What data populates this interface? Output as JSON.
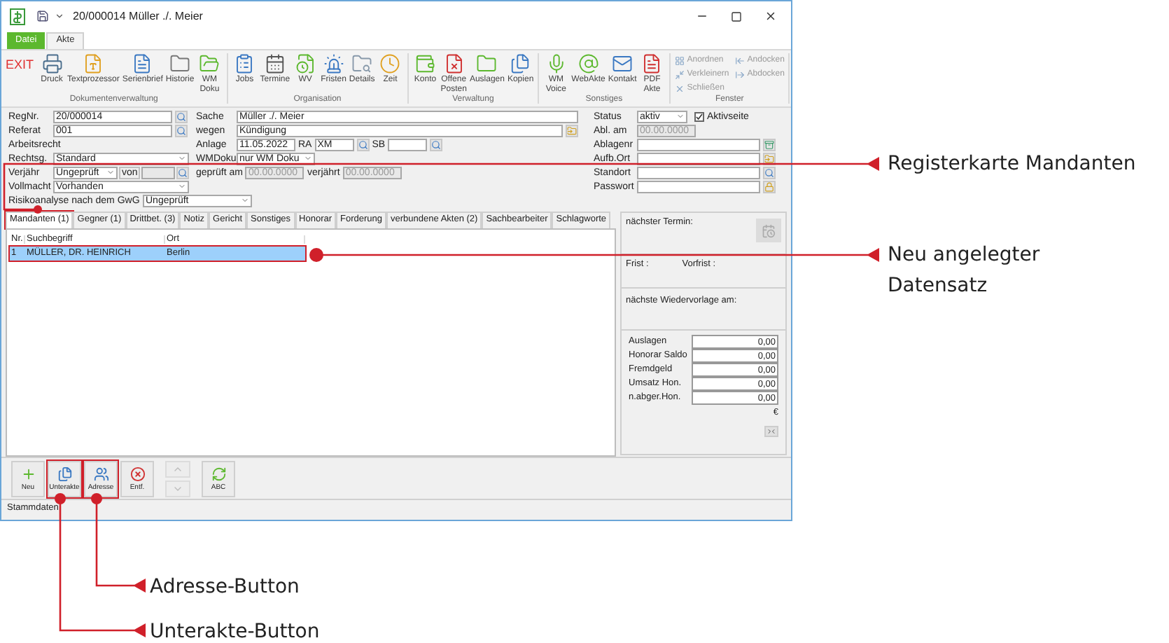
{
  "window": {
    "title": "20/000014 Müller ./. Meier"
  },
  "ribbon_tabs": [
    {
      "label": "Datei",
      "kind": "file",
      "selected": false
    },
    {
      "label": "Akte",
      "kind": "tab",
      "selected": true
    }
  ],
  "ribbon_groups": [
    {
      "title": "Dokumentenverwaltung",
      "buttons": [
        {
          "kind": "exit",
          "label": "EXIT"
        },
        {
          "kind": "large",
          "label": "Druck"
        },
        {
          "kind": "large",
          "label": "Textprozessor"
        },
        {
          "kind": "large",
          "label": "Serienbrief"
        },
        {
          "kind": "large",
          "label": "Historie"
        },
        {
          "kind": "large",
          "label": "WM Doku"
        }
      ]
    },
    {
      "title": "Organisation",
      "buttons": [
        {
          "kind": "large",
          "label": "Jobs"
        },
        {
          "kind": "large",
          "label": "Termine"
        },
        {
          "kind": "large",
          "label": "WV"
        },
        {
          "kind": "large",
          "label": "Fristen"
        },
        {
          "kind": "large",
          "label": "Details"
        },
        {
          "kind": "large",
          "label": "Zeit"
        }
      ]
    },
    {
      "title": "Verwaltung",
      "buttons": [
        {
          "kind": "large",
          "label": "Konto"
        },
        {
          "kind": "large",
          "label": "Offene Posten"
        },
        {
          "kind": "large",
          "label": "Auslagen"
        },
        {
          "kind": "large",
          "label": "Kopien"
        }
      ]
    },
    {
      "title": "Sonstiges",
      "buttons": [
        {
          "kind": "large",
          "label": "WM Voice"
        },
        {
          "kind": "large",
          "label": "WebAkte"
        },
        {
          "kind": "large",
          "label": "Kontakt"
        },
        {
          "kind": "large",
          "label": "PDF Akte"
        }
      ]
    },
    {
      "title": "Fenster",
      "buttons": [
        {
          "kind": "small",
          "label": "Anordnen",
          "disabled": true
        },
        {
          "kind": "small",
          "label": "Verkleinern",
          "disabled": true
        },
        {
          "kind": "small",
          "label": "Schließen",
          "disabled": true
        },
        {
          "kind": "small",
          "label": "Andocken",
          "disabled": true
        },
        {
          "kind": "small",
          "label": "Abdocken",
          "disabled": true
        }
      ]
    }
  ],
  "form": {
    "regnr": {
      "label": "RegNr.",
      "value": "20/000014"
    },
    "referat": {
      "label": "Referat",
      "value": "001"
    },
    "arbeitsrecht": "Arbeitsrecht",
    "rechtsg": {
      "label": "Rechtsg.",
      "value": "Standard"
    },
    "verjaehr": {
      "label": "Verjähr",
      "value": "Ungeprüft",
      "von": "von"
    },
    "vollmacht": {
      "label": "Vollmacht",
      "value": "Vorhanden"
    },
    "risiko": {
      "label": "Risikoanalyse nach dem GwG",
      "value": "Ungeprüft"
    },
    "sache": {
      "label": "Sache",
      "value": "Müller ./. Meier"
    },
    "wegen": {
      "label": "wegen",
      "value": "Kündigung"
    },
    "anlage": {
      "label": "Anlage",
      "value": "11.05.2022",
      "ra_label": "RA",
      "ra_value": "XM",
      "sb_label": "SB"
    },
    "wmdoku": {
      "label": "WMDoku",
      "value": "nur WM Doku"
    },
    "geprueft": {
      "label": "geprüft am",
      "placeholder": "00.00.0000"
    },
    "verjaehrt": {
      "label": "verjährt",
      "placeholder": "00.00.0000"
    },
    "status": {
      "label": "Status",
      "value": "aktiv"
    },
    "aktivseite": {
      "label": "Aktivseite",
      "checked": true
    },
    "abl_am": {
      "label": "Abl. am",
      "placeholder": "00.00.0000"
    },
    "side_fields": [
      {
        "label": "Ablagenr"
      },
      {
        "label": "Aufb.Ort"
      },
      {
        "label": "Standort"
      },
      {
        "label": "Passwort"
      }
    ]
  },
  "register_tabs": [
    {
      "label": "Mandanten (1)",
      "selected": true,
      "highlighted": true
    },
    {
      "label": "Gegner (1)",
      "selected": false,
      "highlighted": false
    },
    {
      "label": "Drittbet. (3)",
      "selected": false,
      "highlighted": false
    },
    {
      "label": "Notiz",
      "selected": false,
      "highlighted": false
    },
    {
      "label": "Gericht",
      "selected": false,
      "highlighted": false
    },
    {
      "label": "Sonstiges",
      "selected": false,
      "highlighted": false
    },
    {
      "label": "Honorar",
      "selected": false,
      "highlighted": false
    },
    {
      "label": "Forderung",
      "selected": false,
      "highlighted": false
    },
    {
      "label": "verbundene Akten (2)",
      "selected": false,
      "highlighted": false
    },
    {
      "label": "Sachbearbeiter",
      "selected": false,
      "highlighted": false
    },
    {
      "label": "Schlagworte",
      "selected": false,
      "highlighted": false
    }
  ],
  "table": {
    "columns": [
      "Nr.",
      "Suchbegriff",
      "Ort"
    ],
    "rows": [
      {
        "cells": [
          "1",
          "MÜLLER, DR. HEINRICH",
          "Berlin"
        ],
        "selected": true,
        "highlighted": true
      }
    ]
  },
  "side_panel": {
    "next_appointment": "nächster Termin:",
    "frist": "Frist :",
    "vorfrist": "Vorfrist :",
    "resubmission": "nächste Wiedervorlage am:",
    "amounts": [
      {
        "label": "Auslagen",
        "value": "0,00"
      },
      {
        "label": "Honorar Saldo",
        "value": "0,00"
      },
      {
        "label": "Fremdgeld",
        "value": "0,00"
      },
      {
        "label": "Umsatz Hon.",
        "value": "0,00"
      },
      {
        "label": "n.abger.Hon.",
        "value": "0,00"
      }
    ],
    "currency": "€"
  },
  "bottom_buttons": [
    {
      "kind": "new",
      "label": "Neu",
      "disabled": false,
      "highlighted": false
    },
    {
      "kind": "sub",
      "label": "Unterakte",
      "disabled": false,
      "highlighted": true
    },
    {
      "kind": "address",
      "label": "Adresse",
      "disabled": false,
      "highlighted": true
    },
    {
      "kind": "delete",
      "label": "Entf.",
      "disabled": false,
      "highlighted": false
    },
    {
      "kind": "up",
      "disabled": true,
      "highlighted": false
    },
    {
      "kind": "down",
      "disabled": true,
      "highlighted": false
    },
    {
      "kind": "abc",
      "label": "ABC",
      "disabled": false,
      "highlighted": false
    }
  ],
  "status_bar": "Stammdaten",
  "annotations": [
    {
      "text": "Registerkarte Mandanten"
    },
    {
      "text": "Neu angelegter Datensatz"
    },
    {
      "text": "Adresse-Button"
    },
    {
      "text": "Unterakte-Button"
    }
  ]
}
